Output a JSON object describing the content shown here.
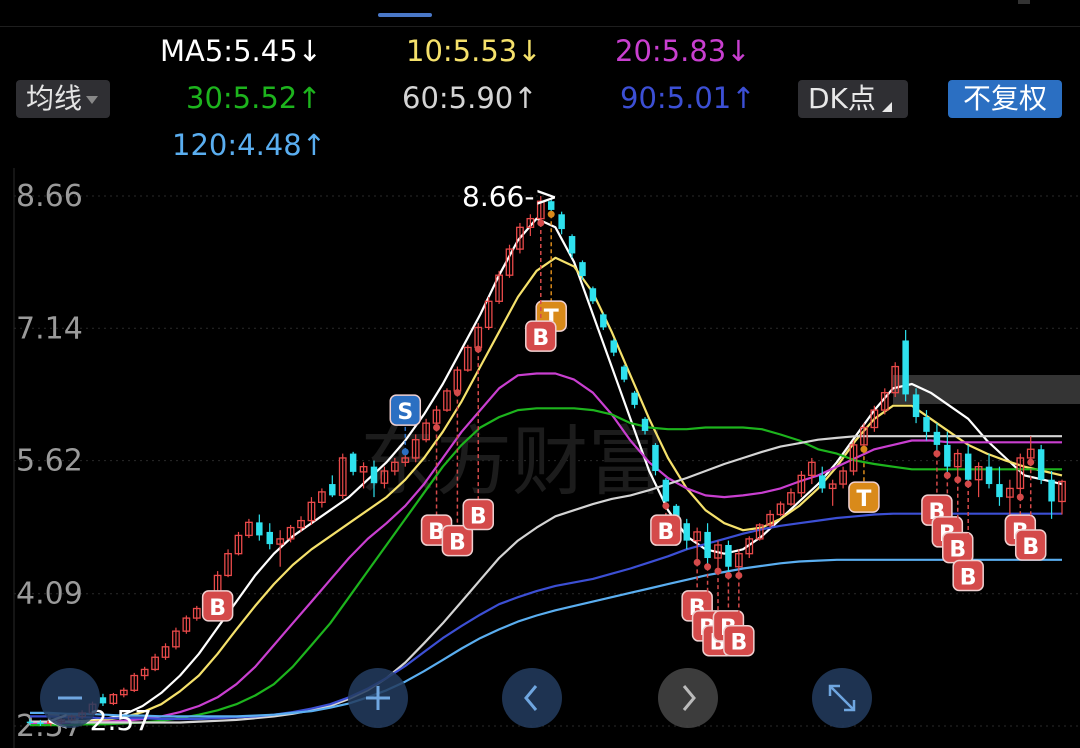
{
  "ma_legend": [
    {
      "label": "MA5:5.45",
      "arrow": "↓",
      "color": "#ffffff"
    },
    {
      "label": "10:5.53",
      "arrow": "↓",
      "color": "#f5e16b"
    },
    {
      "label": "20:5.83",
      "arrow": "↓",
      "color": "#c93fd0"
    },
    {
      "label": "30:5.52",
      "arrow": "↑",
      "color": "#1db41d"
    },
    {
      "label": "60:5.90",
      "arrow": "↑",
      "color": "#d4d4d4"
    },
    {
      "label": "90:5.01",
      "arrow": "↑",
      "color": "#3c4fd4"
    },
    {
      "label": "120:4.48",
      "arrow": "↑",
      "color": "#5aaef0"
    }
  ],
  "controls": {
    "ma_type": "均线",
    "dk_label": "DK点",
    "fq_label": "不复权"
  },
  "watermark": "东方财富",
  "colors": {
    "up": "#ea4a4a",
    "down": "#2ee1ee",
    "accent": "#2b6fc2",
    "signal_b": "#d44a4a",
    "signal_t": "#d98a1a",
    "signal_s": "#2b6fc2"
  },
  "chart_data": {
    "type": "candlestick",
    "ylim": [
      2.57,
      8.66
    ],
    "y_ticks": [
      "8.66",
      "7.14",
      "5.62",
      "4.09",
      "2.57"
    ],
    "max_label": "8.66->",
    "min_label": "<--2.57",
    "candles": [
      [
        2.62,
        2.65,
        2.58,
        2.61
      ],
      [
        2.61,
        2.64,
        2.57,
        2.6
      ],
      [
        2.6,
        2.63,
        2.57,
        2.62
      ],
      [
        2.62,
        2.66,
        2.59,
        2.64
      ],
      [
        2.64,
        2.7,
        2.62,
        2.68
      ],
      [
        2.68,
        2.75,
        2.65,
        2.72
      ],
      [
        2.72,
        2.85,
        2.7,
        2.82
      ],
      [
        2.9,
        2.94,
        2.8,
        2.83
      ],
      [
        2.83,
        2.95,
        2.81,
        2.93
      ],
      [
        2.93,
        3.01,
        2.9,
        2.98
      ],
      [
        2.98,
        3.18,
        2.96,
        3.15
      ],
      [
        3.15,
        3.25,
        3.1,
        3.22
      ],
      [
        3.22,
        3.4,
        3.2,
        3.36
      ],
      [
        3.36,
        3.52,
        3.33,
        3.48
      ],
      [
        3.48,
        3.7,
        3.45,
        3.66
      ],
      [
        3.66,
        3.84,
        3.63,
        3.81
      ],
      [
        3.81,
        3.95,
        3.78,
        3.92
      ],
      [
        3.92,
        4.1,
        3.9,
        4.05
      ],
      [
        4.05,
        4.35,
        4.02,
        4.3
      ],
      [
        4.3,
        4.6,
        4.28,
        4.55
      ],
      [
        4.55,
        4.8,
        4.53,
        4.76
      ],
      [
        4.76,
        4.95,
        4.73,
        4.91
      ],
      [
        4.91,
        5.0,
        4.7,
        4.76
      ],
      [
        4.8,
        4.9,
        4.6,
        4.66
      ],
      [
        4.66,
        4.82,
        4.4,
        4.72
      ],
      [
        4.72,
        4.88,
        4.68,
        4.85
      ],
      [
        4.85,
        4.98,
        4.8,
        4.93
      ],
      [
        4.93,
        5.2,
        4.88,
        5.14
      ],
      [
        5.14,
        5.3,
        5.08,
        5.26
      ],
      [
        5.35,
        5.45,
        5.2,
        5.22
      ],
      [
        5.22,
        5.7,
        5.18,
        5.65
      ],
      [
        5.7,
        5.72,
        5.45,
        5.49
      ],
      [
        5.49,
        5.6,
        5.3,
        5.55
      ],
      [
        5.55,
        5.62,
        5.2,
        5.36
      ],
      [
        5.36,
        5.55,
        5.3,
        5.5
      ],
      [
        5.5,
        5.65,
        5.45,
        5.6
      ],
      [
        5.6,
        5.72,
        5.55,
        5.65
      ],
      [
        5.65,
        5.92,
        5.6,
        5.86
      ],
      [
        5.86,
        6.1,
        5.83,
        6.05
      ],
      [
        6.05,
        6.25,
        6.0,
        6.2
      ],
      [
        6.2,
        6.45,
        6.18,
        6.42
      ],
      [
        6.42,
        6.7,
        6.4,
        6.66
      ],
      [
        6.66,
        6.95,
        6.64,
        6.92
      ],
      [
        6.92,
        7.2,
        6.9,
        7.15
      ],
      [
        7.15,
        7.5,
        7.12,
        7.45
      ],
      [
        7.45,
        7.8,
        7.42,
        7.75
      ],
      [
        7.75,
        8.1,
        7.72,
        8.05
      ],
      [
        8.05,
        8.35,
        8.0,
        8.3
      ],
      [
        8.3,
        8.45,
        8.2,
        8.4
      ],
      [
        8.4,
        8.66,
        8.35,
        8.6
      ],
      [
        8.6,
        8.62,
        8.45,
        8.5
      ],
      [
        8.45,
        8.48,
        8.22,
        8.28
      ],
      [
        8.2,
        8.22,
        7.95,
        8.0
      ],
      [
        7.9,
        7.92,
        7.7,
        7.74
      ],
      [
        7.6,
        7.62,
        7.42,
        7.45
      ],
      [
        7.3,
        7.32,
        7.12,
        7.15
      ],
      [
        7.0,
        7.02,
        6.82,
        6.86
      ],
      [
        6.7,
        6.72,
        6.52,
        6.55
      ],
      [
        6.4,
        6.42,
        6.22,
        6.26
      ],
      [
        6.1,
        6.12,
        5.92,
        5.96
      ],
      [
        5.8,
        5.82,
        5.45,
        5.5
      ],
      [
        5.4,
        5.42,
        5.1,
        5.15
      ],
      [
        5.1,
        5.12,
        4.85,
        4.9
      ],
      [
        4.9,
        4.95,
        4.6,
        4.7
      ],
      [
        4.7,
        4.85,
        4.45,
        4.8
      ],
      [
        4.8,
        4.9,
        4.4,
        4.5
      ],
      [
        4.5,
        4.7,
        4.35,
        4.65
      ],
      [
        4.65,
        4.7,
        4.3,
        4.4
      ],
      [
        4.4,
        4.6,
        4.3,
        4.55
      ],
      [
        4.55,
        4.75,
        4.5,
        4.72
      ],
      [
        4.72,
        4.9,
        4.7,
        4.88
      ],
      [
        4.88,
        5.05,
        4.85,
        5.0
      ],
      [
        5.0,
        5.15,
        4.98,
        5.12
      ],
      [
        5.12,
        5.3,
        5.1,
        5.25
      ],
      [
        5.25,
        5.5,
        5.2,
        5.45
      ],
      [
        5.45,
        5.65,
        5.35,
        5.6
      ],
      [
        5.45,
        5.55,
        5.25,
        5.3
      ],
      [
        5.3,
        5.4,
        5.1,
        5.35
      ],
      [
        5.35,
        5.55,
        5.3,
        5.5
      ],
      [
        5.5,
        5.85,
        5.45,
        5.8
      ],
      [
        5.8,
        6.05,
        5.75,
        6.0
      ],
      [
        6.0,
        6.25,
        5.95,
        6.2
      ],
      [
        6.2,
        6.45,
        6.15,
        6.4
      ],
      [
        6.4,
        6.75,
        6.35,
        6.7
      ],
      [
        7.0,
        7.12,
        6.3,
        6.38
      ],
      [
        6.38,
        6.45,
        6.05,
        6.12
      ],
      [
        6.12,
        6.2,
        5.85,
        5.95
      ],
      [
        5.95,
        6.05,
        5.7,
        5.8
      ],
      [
        5.8,
        5.95,
        5.45,
        5.55
      ],
      [
        5.55,
        5.75,
        5.4,
        5.7
      ],
      [
        5.7,
        5.8,
        5.35,
        5.4
      ],
      [
        5.4,
        5.6,
        5.2,
        5.55
      ],
      [
        5.55,
        5.7,
        5.3,
        5.35
      ],
      [
        5.35,
        5.55,
        5.1,
        5.2
      ],
      [
        5.2,
        5.4,
        5.0,
        5.3
      ],
      [
        5.3,
        5.7,
        5.2,
        5.65
      ],
      [
        5.65,
        5.9,
        5.6,
        5.75
      ],
      [
        5.75,
        5.8,
        5.35,
        5.4
      ],
      [
        5.4,
        5.5,
        4.95,
        5.15
      ],
      [
        5.15,
        5.4,
        5.0,
        5.38
      ]
    ],
    "markers": [
      {
        "text": "B",
        "i": 18,
        "price": 3.95
      },
      {
        "text": "S",
        "i": 36,
        "price": 6.2
      },
      {
        "text": "B",
        "i": 39,
        "price": 4.82
      },
      {
        "text": "B",
        "i": 41,
        "price": 4.7
      },
      {
        "text": "B",
        "i": 43,
        "price": 5.0
      },
      {
        "text": "T",
        "i": 50,
        "price": 7.28
      },
      {
        "text": "B",
        "i": 49,
        "price": 7.05
      },
      {
        "text": "B",
        "i": 61,
        "price": 4.82
      },
      {
        "text": "B",
        "i": 64,
        "price": 3.95
      },
      {
        "text": "B",
        "i": 65,
        "price": 3.72
      },
      {
        "text": "B",
        "i": 66,
        "price": 3.55
      },
      {
        "text": "B",
        "i": 67,
        "price": 3.72
      },
      {
        "text": "B",
        "i": 68,
        "price": 3.55
      },
      {
        "text": "T",
        "i": 80,
        "price": 5.2
      },
      {
        "text": "B",
        "i": 87,
        "price": 5.05
      },
      {
        "text": "B",
        "i": 88,
        "price": 4.8
      },
      {
        "text": "B",
        "i": 89,
        "price": 4.62
      },
      {
        "text": "B",
        "i": 90,
        "price": 4.3
      },
      {
        "text": "B",
        "i": 95,
        "price": 4.82
      },
      {
        "text": "B",
        "i": 96,
        "price": 4.65
      }
    ],
    "ma_lines": [
      {
        "name": "MA5",
        "color": "#ffffff",
        "values": [
          2.62,
          2.62,
          2.62,
          2.63,
          2.65,
          2.7,
          2.8,
          2.95,
          3.15,
          3.4,
          3.7,
          4.0,
          4.3,
          4.55,
          4.75,
          4.9,
          5.05,
          5.2,
          5.4,
          5.6,
          5.85,
          6.15,
          6.5,
          6.9,
          7.3,
          7.75,
          8.15,
          8.4,
          8.3,
          7.9,
          7.3,
          6.7,
          6.1,
          5.5,
          5.05,
          4.75,
          4.6,
          4.55,
          4.6,
          4.75,
          4.95,
          5.15,
          5.35,
          5.6,
          5.9,
          6.2,
          6.45,
          6.5,
          6.4,
          6.25,
          6.1,
          5.85,
          5.65,
          5.45,
          5.4,
          5.35
        ]
      },
      {
        "name": "MA10",
        "color": "#f5e16b",
        "values": [
          2.61,
          2.61,
          2.62,
          2.62,
          2.64,
          2.67,
          2.73,
          2.82,
          2.97,
          3.15,
          3.4,
          3.68,
          3.95,
          4.2,
          4.42,
          4.6,
          4.75,
          4.9,
          5.05,
          5.2,
          5.4,
          5.65,
          5.95,
          6.3,
          6.7,
          7.1,
          7.5,
          7.8,
          7.95,
          7.85,
          7.55,
          7.1,
          6.6,
          6.1,
          5.65,
          5.3,
          5.05,
          4.9,
          4.82,
          4.85,
          4.95,
          5.1,
          5.3,
          5.55,
          5.85,
          6.1,
          6.25,
          6.25,
          6.1,
          5.95,
          5.8,
          5.7,
          5.62,
          5.55,
          5.5,
          5.45
        ]
      },
      {
        "name": "MA20",
        "color": "#c93fd0",
        "values": [
          2.6,
          2.6,
          2.61,
          2.61,
          2.62,
          2.63,
          2.65,
          2.68,
          2.73,
          2.8,
          2.9,
          3.05,
          3.25,
          3.5,
          3.75,
          4.0,
          4.25,
          4.5,
          4.72,
          4.9,
          5.1,
          5.35,
          5.65,
          5.95,
          6.2,
          6.45,
          6.6,
          6.62,
          6.62,
          6.55,
          6.4,
          6.15,
          5.85,
          5.6,
          5.42,
          5.3,
          5.22,
          5.2,
          5.22,
          5.25,
          5.3,
          5.38,
          5.45,
          5.55,
          5.65,
          5.75,
          5.8,
          5.85,
          5.85,
          5.83,
          5.83,
          5.83,
          5.83,
          5.83,
          5.83,
          5.83
        ]
      },
      {
        "name": "MA30",
        "color": "#1db41d",
        "values": [
          2.58,
          2.58,
          2.58,
          2.59,
          2.59,
          2.6,
          2.61,
          2.63,
          2.66,
          2.7,
          2.75,
          2.82,
          2.92,
          3.05,
          3.25,
          3.5,
          3.75,
          4.05,
          4.35,
          4.65,
          4.95,
          5.25,
          5.55,
          5.8,
          6.0,
          6.12,
          6.2,
          6.22,
          6.22,
          6.22,
          6.2,
          6.15,
          6.05,
          6.0,
          5.98,
          5.98,
          6.0,
          6.0,
          6.0,
          5.98,
          5.92,
          5.85,
          5.75,
          5.7,
          5.62,
          5.58,
          5.55,
          5.52,
          5.52,
          5.52,
          5.52,
          5.52,
          5.52,
          5.52,
          5.52,
          5.52
        ]
      },
      {
        "name": "MA60",
        "color": "#d4d4d4",
        "values": [
          2.62,
          2.62,
          2.62,
          2.61,
          2.61,
          2.61,
          2.61,
          2.61,
          2.61,
          2.62,
          2.63,
          2.64,
          2.66,
          2.68,
          2.71,
          2.75,
          2.8,
          2.88,
          2.98,
          3.12,
          3.3,
          3.52,
          3.75,
          4.0,
          4.25,
          4.5,
          4.7,
          4.85,
          4.98,
          5.05,
          5.12,
          5.18,
          5.22,
          5.28,
          5.35,
          5.42,
          5.5,
          5.58,
          5.65,
          5.72,
          5.78,
          5.82,
          5.86,
          5.88,
          5.9,
          5.9,
          5.9,
          5.9,
          5.9,
          5.9,
          5.9,
          5.9,
          5.9,
          5.9,
          5.9,
          5.9
        ]
      },
      {
        "name": "MA90",
        "color": "#3c4fd4",
        "values": [
          2.68,
          2.68,
          2.67,
          2.67,
          2.66,
          2.66,
          2.66,
          2.65,
          2.65,
          2.65,
          2.66,
          2.67,
          2.68,
          2.7,
          2.73,
          2.77,
          2.82,
          2.9,
          3.0,
          3.12,
          3.26,
          3.42,
          3.58,
          3.72,
          3.85,
          3.97,
          4.05,
          4.12,
          4.18,
          4.22,
          4.26,
          4.32,
          4.38,
          4.45,
          4.52,
          4.6,
          4.66,
          4.72,
          4.78,
          4.83,
          4.87,
          4.9,
          4.93,
          4.96,
          4.98,
          5.0,
          5.01,
          5.01,
          5.01,
          5.01,
          5.01,
          5.01,
          5.01,
          5.01,
          5.01,
          5.01
        ]
      },
      {
        "name": "MA120",
        "color": "#5aaef0",
        "values": [
          2.72,
          2.72,
          2.71,
          2.71,
          2.7,
          2.69,
          2.69,
          2.68,
          2.68,
          2.68,
          2.68,
          2.68,
          2.69,
          2.7,
          2.72,
          2.74,
          2.78,
          2.83,
          2.9,
          2.98,
          3.08,
          3.2,
          3.33,
          3.46,
          3.58,
          3.68,
          3.77,
          3.84,
          3.9,
          3.95,
          4.0,
          4.05,
          4.1,
          4.15,
          4.2,
          4.25,
          4.3,
          4.34,
          4.38,
          4.41,
          4.44,
          4.46,
          4.47,
          4.48,
          4.48,
          4.48,
          4.48,
          4.48,
          4.48,
          4.48,
          4.48,
          4.48,
          4.48,
          4.48,
          4.48,
          4.48
        ]
      }
    ]
  },
  "fab_buttons": [
    "zoom-out",
    "zoom-in",
    "prev",
    "next",
    "fullscreen"
  ]
}
